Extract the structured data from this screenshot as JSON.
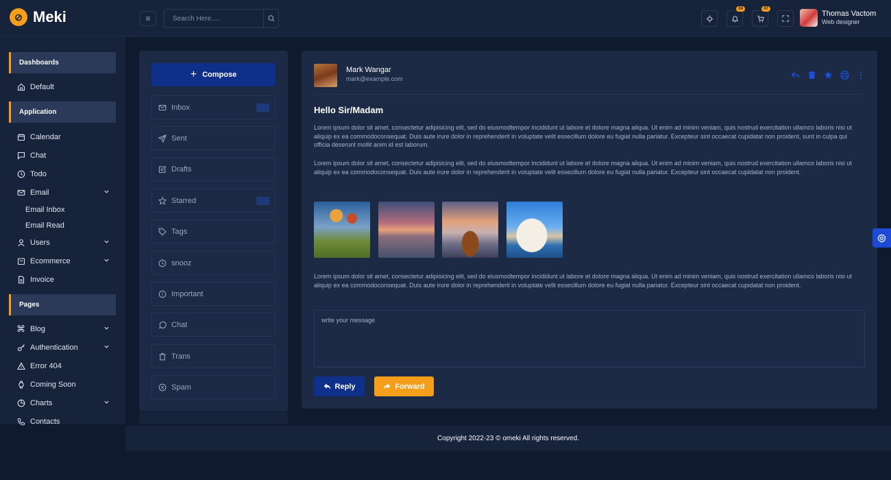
{
  "header": {
    "logo_text": "Meki",
    "search_placeholder": "Search Here.....",
    "notifications_count": "04",
    "cart_count": "07",
    "user_name": "Thomas Vactom",
    "user_role": "Web designer"
  },
  "sidebar": {
    "sections": [
      "Dashboards",
      "Application",
      "Pages"
    ],
    "items": {
      "default": "Default",
      "calendar": "Calendar",
      "chat": "Chat",
      "todo": "Todo",
      "email": "Email",
      "email_inbox": "Email Inbox",
      "email_read": "Email Read",
      "users": "Users",
      "ecommerce": "Ecommerce",
      "invoice": "Invoice",
      "blog": "Blog",
      "authentication": "Authentication",
      "error404": "Error 404",
      "coming_soon": "Coming Soon",
      "charts": "Charts",
      "contacts": "Contacts"
    }
  },
  "mail_nav": {
    "compose": "Compose",
    "items": [
      "Inbox",
      "Sent",
      "Drafts",
      "Starred",
      "Tags",
      "snooz",
      "Important",
      "Chat",
      "Trans",
      "Spam"
    ]
  },
  "email": {
    "sender_name": "Mark Wangar",
    "sender_email": "mark@example.com",
    "greeting": "Hello Sir/Madam",
    "para1": "Lorem ipsum dolor sit amet, consectetur adipisicing elit, sed do eiusmodtempor incididunt ut labore et dolore magna aliqua. Ut enim ad minim veniam, quis nostrud exercitation ullamco laboris nisi ut aliquip ex ea commodoconsequat. Duis aute irure dolor in reprehenderit in voluptate velit essecillum dolore eu fugiat nulla pariatur. Excepteur sint occaecat cupidatat non proident, sunt in culpa qui officia deserunt mollit anim id est laborum.",
    "para2": "Lorem ipsum dolor sit amet, consectetur adipisicing elit, sed do eiusmodtempor incididunt ut labore et dolore magna aliqua. Ut enim ad minim veniam, quis nostrud exercitation ullamco laboris nisi ut aliquip ex ea commodoconsequat. Duis aute irure dolor in reprehenderit in voluptate velit essecillum dolore eu fugiat nulla pariatur. Excepteur sint occaecat cupidatat non proident.",
    "para3": "Lorem ipsum dolor sit amet, consectetur adipisicing elit, sed do eiusmodtempor incididunt ut labore et dolore magna aliqua. Ut enim ad minim veniam, quis nostrud exercitation ullamco laboris nisi ut aliquip ex ea commodoconsequat. Duis aute irure dolor in reprehenderit in voluptate velit essecillum dolore eu fugiat nulla pariatur. Excepteur sint occaecat cupidatat non proident.",
    "message_placeholder": "write your message",
    "reply_label": "Reply",
    "forward_label": "Forward"
  },
  "footer": {
    "copyright": "Copyright 2022-23 © omeki All rights reserved."
  },
  "colors": {
    "accent": "#f59e1b",
    "primary": "#0e2f8a",
    "panel": "#1d2a45",
    "background": "#0f1a2e"
  }
}
